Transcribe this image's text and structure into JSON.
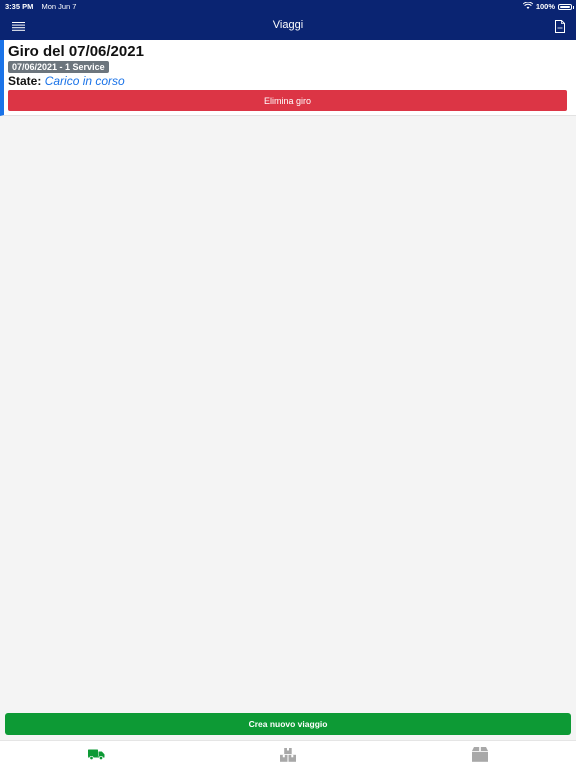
{
  "status_bar": {
    "time": "3:35 PM",
    "date": "Mon Jun 7",
    "battery": "100%"
  },
  "navbar": {
    "title": "Viaggi"
  },
  "trip": {
    "title": "Giro del 07/06/2021",
    "badge": "07/06/2021 - 1 Service",
    "state_label": "State:",
    "state_value": "Carico in corso",
    "delete_label": "Elimina giro"
  },
  "actions": {
    "create_label": "Crea nuovo viaggio"
  },
  "tabs": [
    {
      "icon": "truck-icon",
      "active": true
    },
    {
      "icon": "boxes-icon",
      "active": false
    },
    {
      "icon": "package-icon",
      "active": false
    }
  ],
  "colors": {
    "nav": "#0a2472",
    "accent": "#1a73e8",
    "danger": "#dc3545",
    "success": "#0d9a35",
    "active_tab": "#0d9a35",
    "inactive_tab": "#a8a8a8"
  }
}
